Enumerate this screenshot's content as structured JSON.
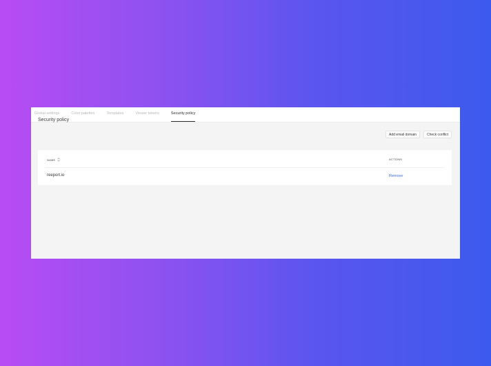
{
  "tabs": [
    {
      "label": "Global settings",
      "active": false
    },
    {
      "label": "Color palettes",
      "active": false
    },
    {
      "label": "Templates",
      "active": false
    },
    {
      "label": "Viewer tokens",
      "active": false
    },
    {
      "label": "Security policy",
      "active": true
    }
  ],
  "page": {
    "title": "Security policy",
    "add_button": "Add email domain",
    "check_button": "Check conflict"
  },
  "table": {
    "columns": {
      "name": "NAME",
      "actions": "ACTIONS"
    },
    "rows": [
      {
        "name": "reeport.io",
        "action": "Remove"
      }
    ]
  },
  "colors": {
    "background_start": "#b84cf4",
    "background_end": "#3d5aee",
    "link": "#3a6ee8"
  },
  "icons": {
    "sort": "sort-icon"
  }
}
